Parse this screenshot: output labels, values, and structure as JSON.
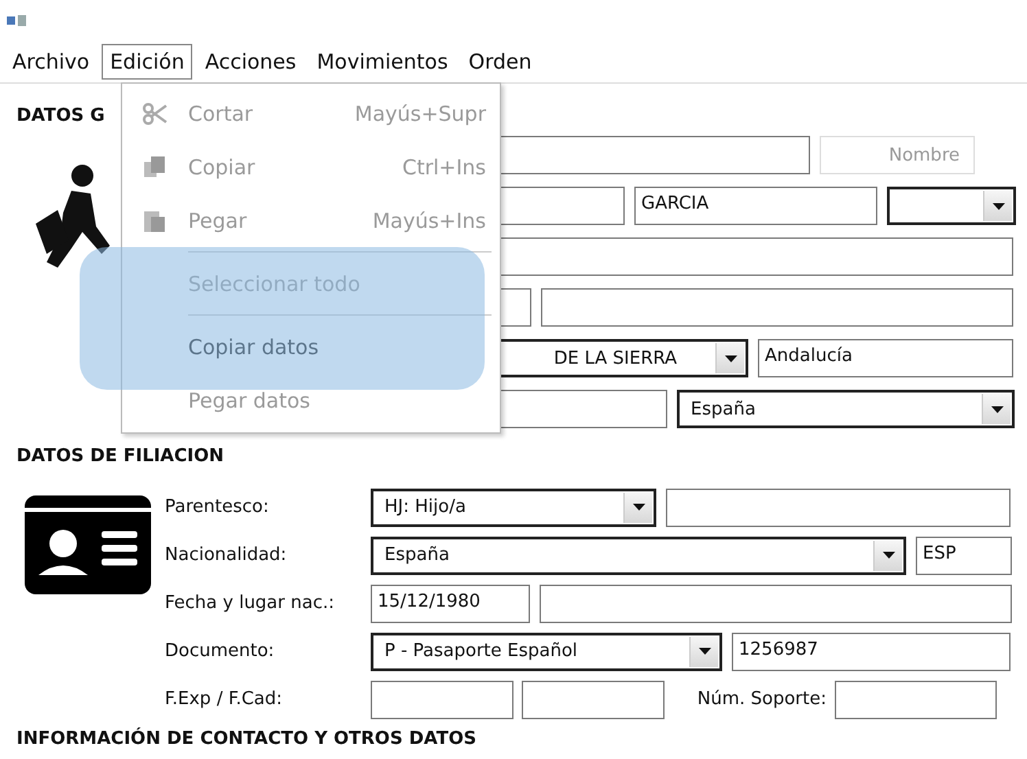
{
  "menubar": [
    {
      "label": "Archivo",
      "selected": false
    },
    {
      "label": "Edición",
      "selected": true
    },
    {
      "label": "Acciones",
      "selected": false
    },
    {
      "label": "Movimientos",
      "selected": false
    },
    {
      "label": "Orden",
      "selected": false
    }
  ],
  "menu": {
    "items": [
      {
        "kind": "item",
        "label": "Cortar",
        "shortcut": "Mayús+Supr",
        "disabled": true
      },
      {
        "kind": "item",
        "label": "Copiar",
        "shortcut": "Ctrl+Ins",
        "disabled": true
      },
      {
        "kind": "item",
        "label": "Pegar",
        "shortcut": "Mayús+Ins",
        "disabled": true
      },
      {
        "kind": "separator"
      },
      {
        "kind": "item",
        "label": "Seleccionar todo",
        "disabled": true
      },
      {
        "kind": "separator"
      },
      {
        "kind": "item",
        "label": "Copiar datos",
        "disabled": false
      },
      {
        "kind": "item",
        "label": "Pegar datos",
        "disabled": true
      }
    ]
  },
  "general": {
    "heading": "DATOS G",
    "rows": [
      [
        {
          "kind": "input"
        },
        {
          "kind": "button",
          "label": "Nombre",
          "disabled": true
        }
      ],
      [
        {
          "kind": "input"
        },
        {
          "kind": "input",
          "value": "GARCIA"
        },
        {
          "kind": "combo"
        }
      ],
      [
        {
          "kind": "input"
        }
      ],
      [
        {
          "kind": "input"
        },
        {
          "kind": "input"
        }
      ],
      [
        {
          "kind": "combo",
          "value": "DE LA SIERRA"
        },
        {
          "kind": "input",
          "value": "Andalucía"
        }
      ],
      [
        {
          "kind": "input"
        },
        {
          "kind": "combo",
          "value": "España"
        }
      ]
    ]
  },
  "filiation": {
    "heading": "DATOS DE FILIACION",
    "rows": [
      {
        "label": "Parentesco:",
        "fields": [
          {
            "kind": "combo",
            "value": "HJ: Hijo/a"
          },
          {
            "kind": "input"
          }
        ]
      },
      {
        "label": "Nacionalidad:",
        "fields": [
          {
            "kind": "combo",
            "value": "España"
          },
          {
            "kind": "input",
            "value": "ESP"
          }
        ]
      },
      {
        "label": "Fecha y lugar nac.:",
        "fields": [
          {
            "kind": "input",
            "value": "15/12/1980"
          },
          {
            "kind": "input"
          }
        ]
      },
      {
        "label": "Documento:",
        "fields": [
          {
            "kind": "combo",
            "value": "P - Pasaporte Español"
          },
          {
            "kind": "input",
            "value": "1256987"
          }
        ]
      },
      {
        "label": "F.Exp / F.Cad:",
        "fields": [
          {
            "kind": "input"
          },
          {
            "kind": "input"
          },
          {
            "kind": "label",
            "text": "Núm. Soporte:"
          },
          {
            "kind": "input"
          }
        ]
      }
    ]
  },
  "contact": {
    "heading": "INFORMACIÓN DE CONTACTO Y OTROS DATOS"
  }
}
